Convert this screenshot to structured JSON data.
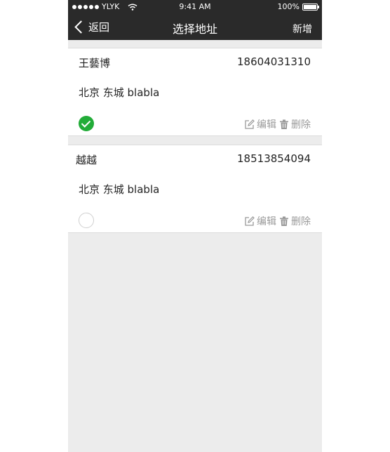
{
  "status_bar": {
    "carrier": "YLYK",
    "time": "9:41 AM",
    "battery": "100%",
    "battery_level": 1.0
  },
  "nav": {
    "back_label": "返回",
    "title": "选择地址",
    "add_label": "新增"
  },
  "addresses": [
    {
      "name": "王藝博",
      "phone": "18604031310",
      "address": "北京 东城 blabla",
      "selected": true,
      "edit_label": "编辑",
      "delete_label": "删除"
    },
    {
      "name": "越越",
      "phone": "18513854094",
      "address": "北京 东城 blabla",
      "selected": false,
      "edit_label": "编辑",
      "delete_label": "删除"
    }
  ],
  "colors": {
    "bar_background": "#2a2a2a",
    "page_background": "#ececec",
    "selected_check": "#22ac38",
    "action_gray": "#9a9a9a"
  },
  "icons": [
    "signal-dots-icon",
    "wifi-icon",
    "battery-icon",
    "back-chevron-icon",
    "checkmark-icon",
    "edit-icon",
    "trash-icon"
  ]
}
